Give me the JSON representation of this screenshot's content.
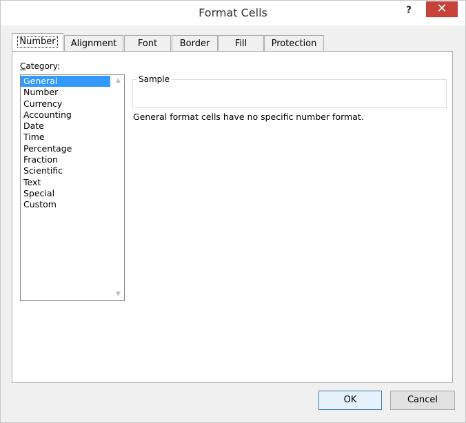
{
  "window": {
    "title": "Format Cells",
    "help_label": "?",
    "close_label": "✕"
  },
  "tabs": [
    {
      "label": "Number",
      "active": true
    },
    {
      "label": "Alignment"
    },
    {
      "label": "Font"
    },
    {
      "label": "Border"
    },
    {
      "label": "Fill"
    },
    {
      "label": "Protection"
    }
  ],
  "category": {
    "label_first": "C",
    "label_rest": "ategory:",
    "items": [
      "General",
      "Number",
      "Currency",
      "Accounting",
      "Date",
      "Time",
      "Percentage",
      "Fraction",
      "Scientific",
      "Text",
      "Special",
      "Custom"
    ],
    "selected": "General"
  },
  "sample": {
    "legend": "Sample",
    "value": ""
  },
  "description": "General format cells have no specific number format.",
  "buttons": {
    "ok": "OK",
    "cancel": "Cancel"
  }
}
